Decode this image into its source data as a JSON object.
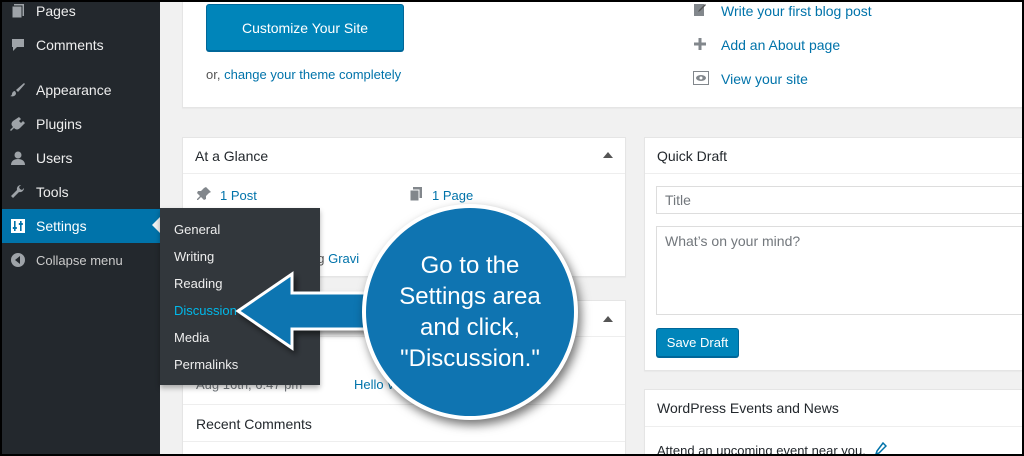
{
  "sidebar": {
    "items": [
      {
        "label": "Pages"
      },
      {
        "label": "Comments"
      },
      {
        "label": "Appearance"
      },
      {
        "label": "Plugins"
      },
      {
        "label": "Users"
      },
      {
        "label": "Tools"
      },
      {
        "label": "Settings"
      },
      {
        "label": "Collapse menu"
      }
    ],
    "settings_submenu": [
      {
        "label": "General"
      },
      {
        "label": "Writing"
      },
      {
        "label": "Reading"
      },
      {
        "label": "Discussion"
      },
      {
        "label": "Media"
      },
      {
        "label": "Permalinks"
      }
    ]
  },
  "welcome": {
    "customize_button": "Customize Your Site",
    "or_text": "or,",
    "change_theme_link": "change your theme completely",
    "next_steps": [
      {
        "label": "Write your first blog post",
        "icon": "edit-icon"
      },
      {
        "label": "Add an About page",
        "icon": "plus-icon"
      },
      {
        "label": "View your site",
        "icon": "view-icon"
      }
    ]
  },
  "at_a_glance": {
    "title": "At a Glance",
    "posts": "1 Post",
    "pages": "1 Page",
    "theme_fragment_text": "ng",
    "theme_fragment_link": "Gravi"
  },
  "activity": {
    "date": "Aug 16th, 6:47 pm",
    "post_link": "Hello W",
    "recent_comments": "Recent Comments"
  },
  "quick_draft": {
    "title": "Quick Draft",
    "title_placeholder": "Title",
    "content_placeholder": "What’s on your mind?",
    "save_button": "Save Draft"
  },
  "events": {
    "title": "WordPress Events and News",
    "text": "Attend an upcoming event near you."
  },
  "callout": {
    "text": "Go to the Settings area and click, \"Discussion.\""
  },
  "colors": {
    "sidebar_bg": "#23282d",
    "active_blue": "#0073aa",
    "callout_blue": "#0f74b1",
    "submenu_current": "#00b9eb"
  }
}
